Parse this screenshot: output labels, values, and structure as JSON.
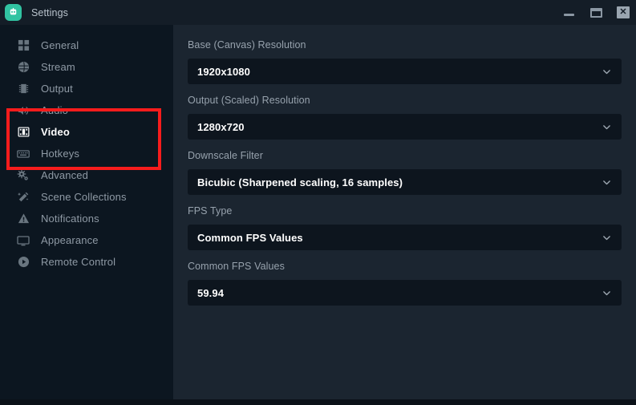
{
  "titlebar": {
    "title": "Settings",
    "logo_icon": "streamlabs-logo-icon",
    "minimize_icon": "minimize-icon",
    "maximize_icon": "maximize-icon",
    "close_icon": "close-icon",
    "close_glyph": "✕"
  },
  "sidebar": {
    "items": [
      {
        "label": "General",
        "icon": "grid-icon",
        "active": false
      },
      {
        "label": "Stream",
        "icon": "globe-icon",
        "active": false
      },
      {
        "label": "Output",
        "icon": "chip-icon",
        "active": false
      },
      {
        "label": "Audio",
        "icon": "speaker-icon",
        "active": false
      },
      {
        "label": "Video",
        "icon": "film-strip-icon",
        "active": true
      },
      {
        "label": "Hotkeys",
        "icon": "keyboard-icon",
        "active": false
      },
      {
        "label": "Advanced",
        "icon": "gears-icon",
        "active": false
      },
      {
        "label": "Scene Collections",
        "icon": "magic-wand-icon",
        "active": false
      },
      {
        "label": "Notifications",
        "icon": "warning-icon",
        "active": false
      },
      {
        "label": "Appearance",
        "icon": "monitor-icon",
        "active": false
      },
      {
        "label": "Remote Control",
        "icon": "play-circle-icon",
        "active": false
      }
    ]
  },
  "main": {
    "fields": [
      {
        "label": "Base (Canvas) Resolution",
        "value": "1920x1080"
      },
      {
        "label": "Output (Scaled) Resolution",
        "value": "1280x720"
      },
      {
        "label": "Downscale Filter",
        "value": "Bicubic (Sharpened scaling, 16 samples)"
      },
      {
        "label": "FPS Type",
        "value": "Common FPS Values"
      },
      {
        "label": "Common FPS Values",
        "value": "59.94"
      }
    ]
  },
  "annotation": {
    "color": "#f71c1c",
    "target": "Output (Scaled) Resolution"
  },
  "colors": {
    "titlebar_bg": "#141d27",
    "sidebar_bg": "#0c1620",
    "main_bg": "#1b2530",
    "select_bg": "#0d151e",
    "accent_teal": "#31c3a2",
    "label_text": "#97a2ad",
    "value_text": "#ffffff",
    "annotation_red": "#f71c1c"
  }
}
